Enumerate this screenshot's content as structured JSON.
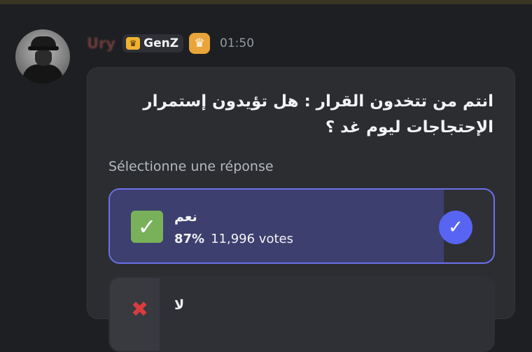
{
  "message": {
    "username": "Ury",
    "tag": {
      "icon": "crown-shield-icon",
      "label": "GenZ",
      "color": "#f0b232"
    },
    "badge": {
      "icon": "crown-icon",
      "color": "#e9a53a"
    },
    "time": "01:50"
  },
  "poll": {
    "question": "انتم من تتخدون القرار : هل تؤيدون إستمرار الإحتجاجات ليوم غد ؟",
    "hint": "Sélectionne une réponse",
    "answers": [
      {
        "emoji": "✅",
        "emoji_name": "check-mark-button-icon",
        "label": "نعم",
        "percent": "87%",
        "votes": "11,996 votes",
        "fill_fraction": 0.87,
        "selected": true
      },
      {
        "emoji_name": "cross-mark-icon",
        "label": "لا",
        "fill_fraction": 0.13,
        "selected": false
      }
    ],
    "accent": "#5865f2"
  }
}
